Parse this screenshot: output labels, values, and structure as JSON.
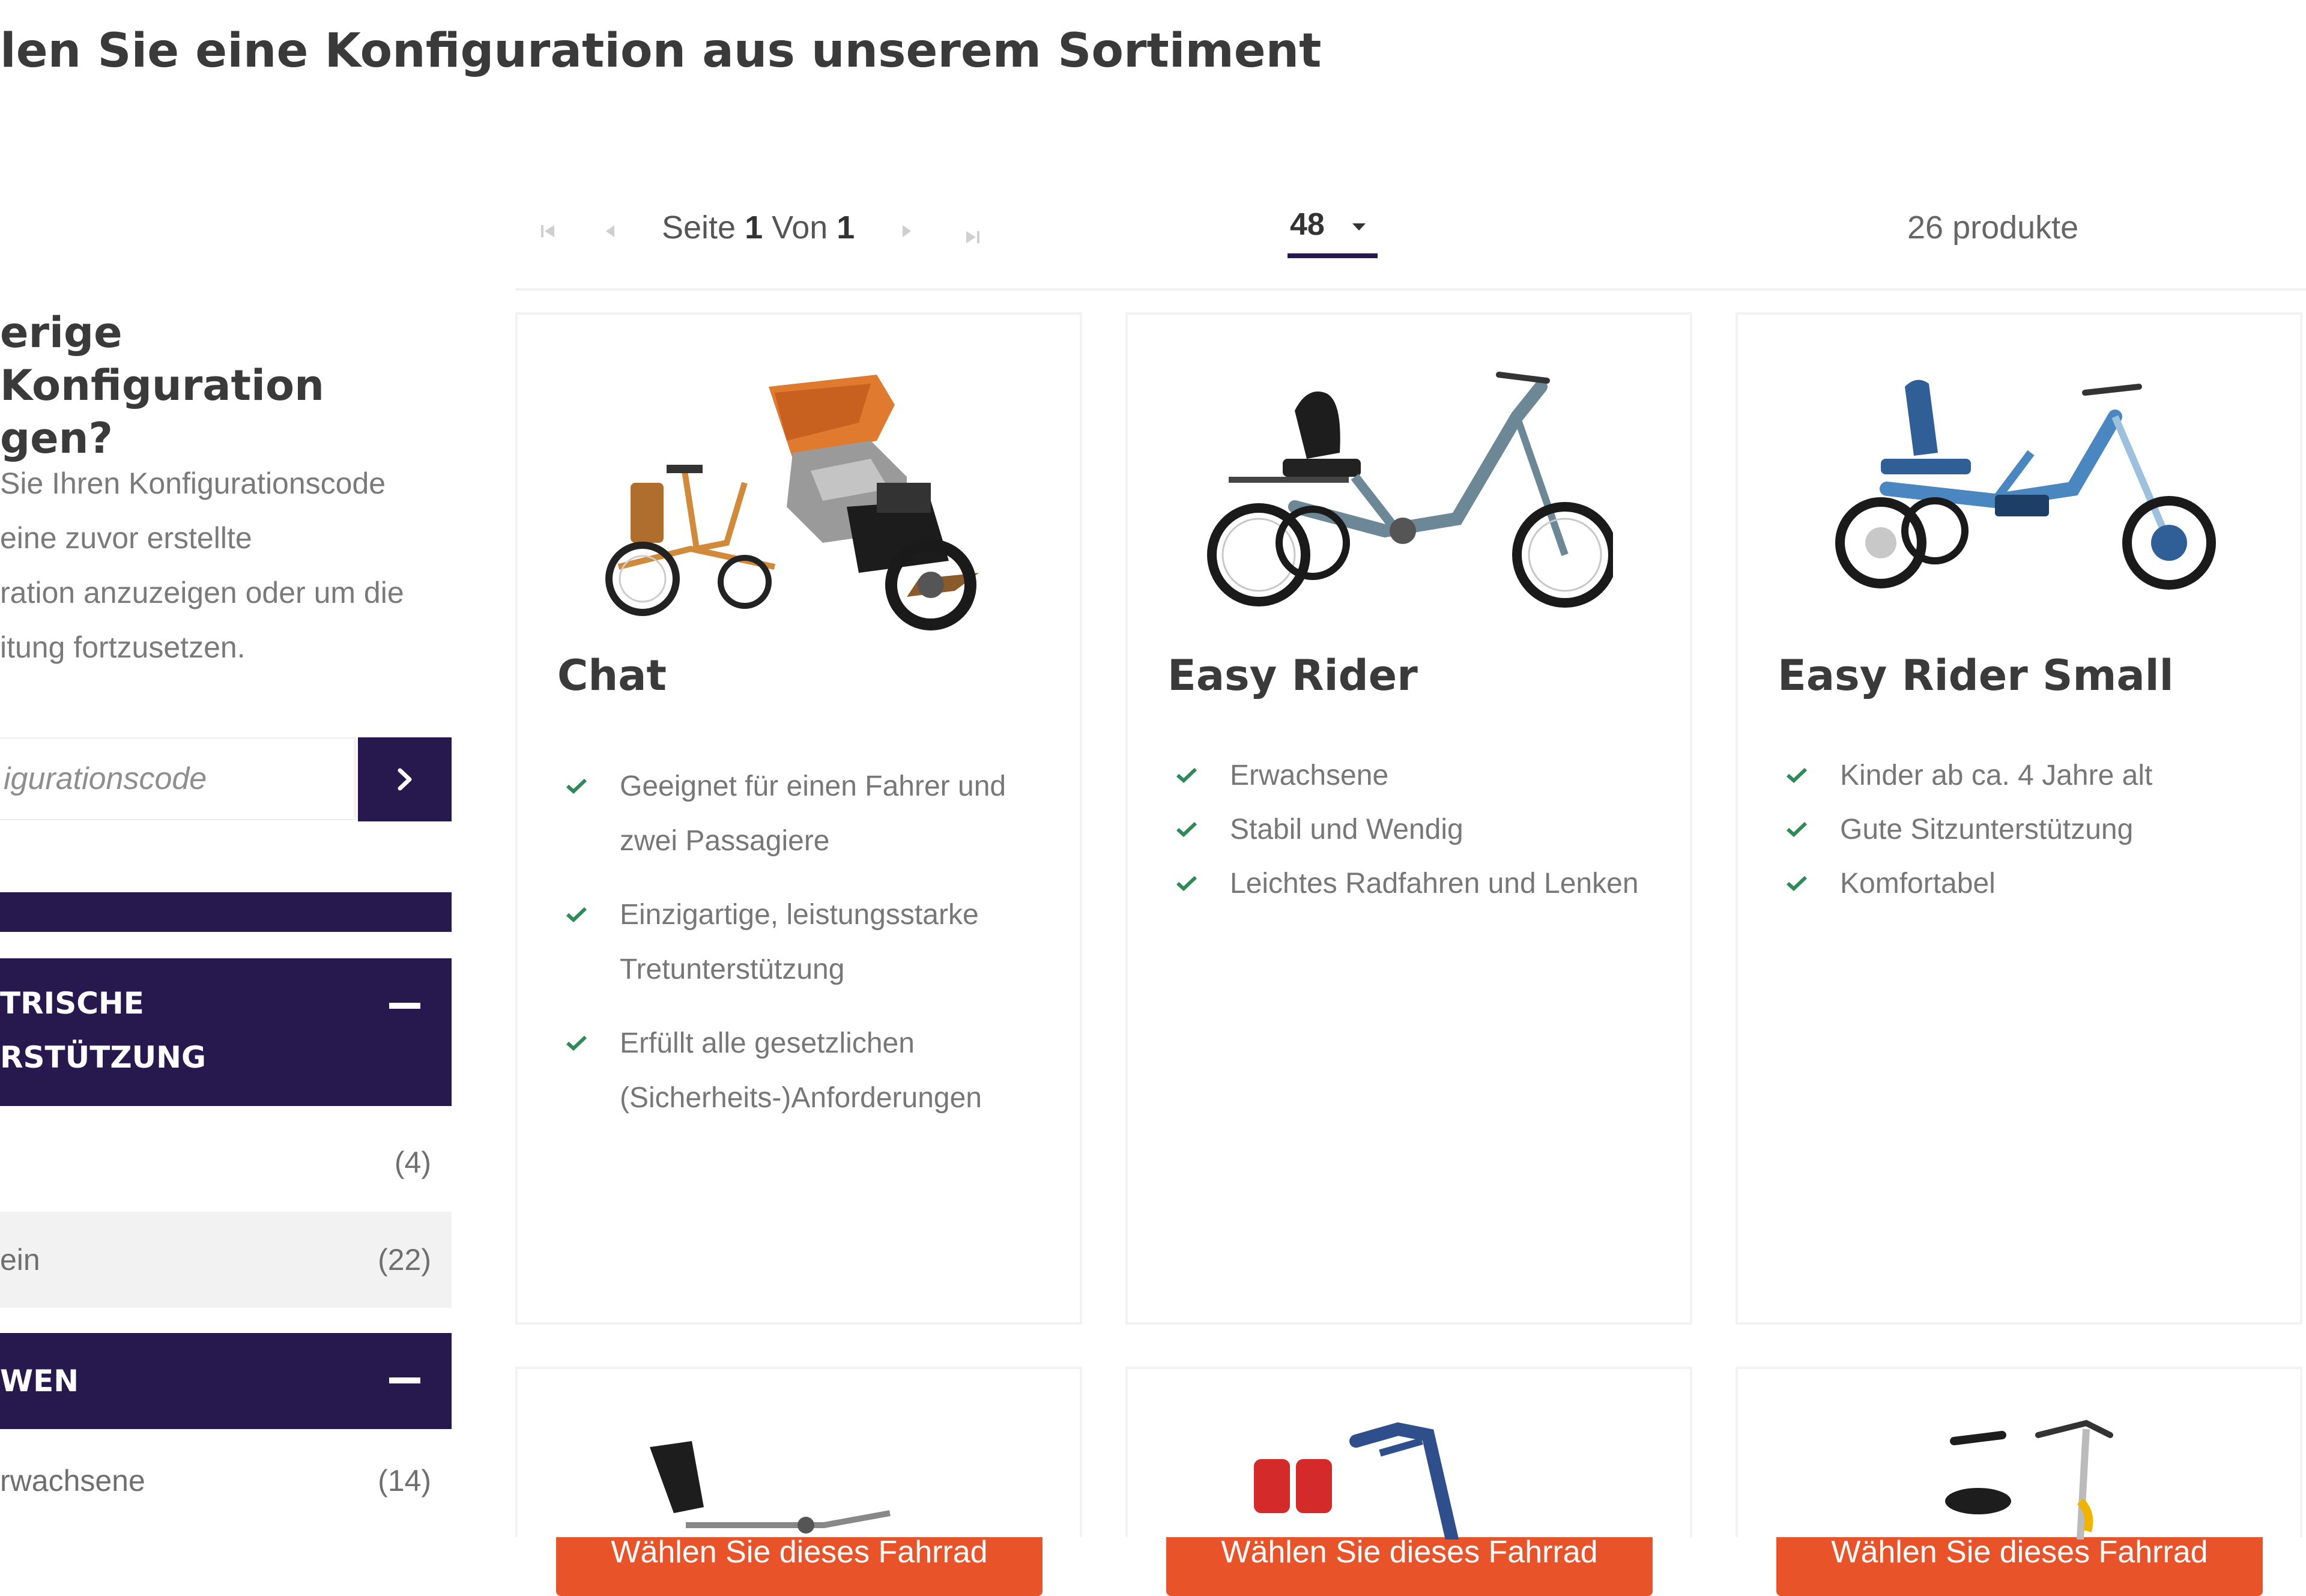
{
  "page": {
    "title": "len Sie eine Konfiguration aus unserem Sortiment"
  },
  "sidebar": {
    "config_heading": "erige Konfiguration\ngen?",
    "config_text": "Sie Ihren Konfigurationscode\n eine zuvor erstellte\nration anzuzeigen oder um die\nitung fortzusetzen.",
    "config_placeholder": "igurationscode",
    "config_submit_icon": "chevron-right-icon",
    "filters": [
      {
        "title": "TRISCHE\nRSTÜTZUNG",
        "options": [
          {
            "label": "",
            "count": "(4)"
          },
          {
            "label": "ein",
            "count": "(22)"
          }
        ]
      },
      {
        "title": "WEN",
        "options": [
          {
            "label": "rwachsene",
            "count": "(14)"
          }
        ]
      }
    ]
  },
  "toolbar": {
    "page_label": "Seite",
    "page_current": "1",
    "page_of": "Von",
    "page_total": "1",
    "per_page": "48",
    "product_count": "26 produkte"
  },
  "products": [
    {
      "name": "Chat",
      "features": [
        "Geeignet für einen Fahrer und zwei Passagiere",
        "Einzigartige, leistungsstarke Tretunterstützung",
        "Erfüllt alle gesetzlichen (Sicherheits-)Anforderungen"
      ],
      "button": "Wählen Sie dieses Fahrrad"
    },
    {
      "name": "Easy Rider",
      "features": [
        "Erwachsene",
        "Stabil und Wendig",
        "Leichtes Radfahren und Lenken"
      ],
      "button": "Wählen Sie dieses Fahrrad"
    },
    {
      "name": "Easy Rider Small",
      "features": [
        "Kinder ab ca. 4 Jahre alt",
        "Gute Sitzunterstützung",
        "Komfortabel"
      ],
      "button": "Wählen Sie dieses Fahrrad"
    }
  ],
  "colors": {
    "navy": "#27184e",
    "orange": "#e8532a",
    "check_green": "#2e8b57"
  }
}
